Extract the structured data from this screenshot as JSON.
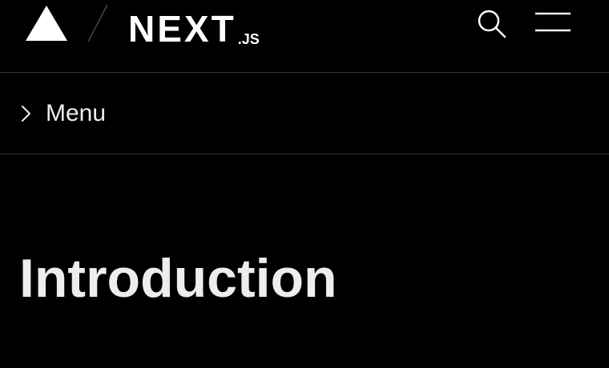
{
  "header": {
    "brand": {
      "word": "NEXT",
      "suffix": ".JS"
    },
    "icons": {
      "logo": "vercel-triangle-icon",
      "divider": "slash-divider",
      "search": "search-icon",
      "menu": "hamburger-menu-icon"
    }
  },
  "nav": {
    "menu_label": "Menu",
    "menu_icon": "chevron-right-icon"
  },
  "main": {
    "title": "Introduction"
  },
  "colors": {
    "background": "#000000",
    "text": "#ededed",
    "border": "#333333"
  }
}
